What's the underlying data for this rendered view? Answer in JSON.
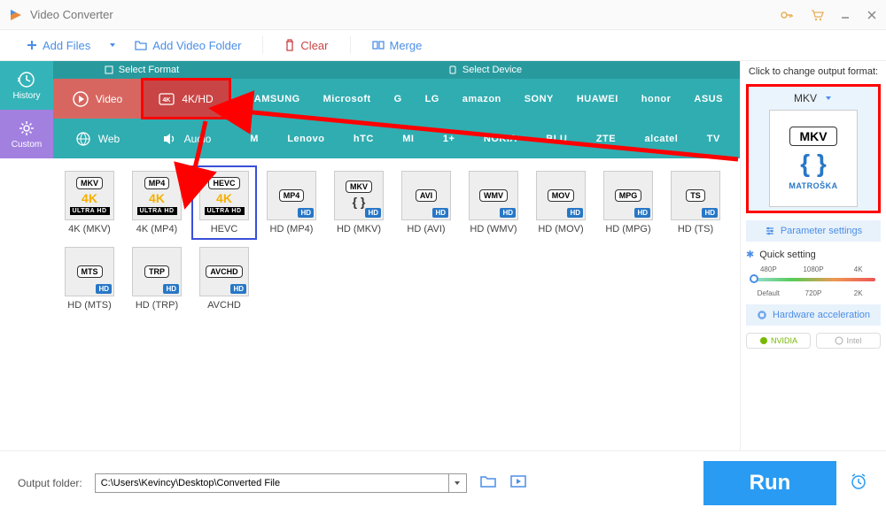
{
  "window": {
    "title": "Video Converter"
  },
  "toolbar": {
    "add_files": "Add Files",
    "add_folder": "Add Video Folder",
    "clear": "Clear",
    "merge": "Merge"
  },
  "left_tabs": {
    "history": "History",
    "custom": "Custom"
  },
  "ribbon": {
    "select_format": "Select Format",
    "select_device": "Select Device",
    "row1": {
      "video": "Video",
      "fourk": "4K/HD",
      "brands": [
        "SAMSUNG",
        "Microsoft",
        "G",
        "LG",
        "amazon",
        "SONY",
        "HUAWEI",
        "honor",
        "ASUS"
      ]
    },
    "row2": {
      "web": "Web",
      "audio": "Audio",
      "brands": [
        "M",
        "Lenovo",
        "hTC",
        "MI",
        "1+",
        "NOKIA",
        "BLU",
        "ZTE",
        "alcatel",
        "TV"
      ]
    }
  },
  "formats": [
    {
      "top": "MKV",
      "mid": "4K",
      "bot": "ULTRA HD",
      "label": "4K (MKV)",
      "midColor": "#f5b000",
      "hd": false
    },
    {
      "top": "MP4",
      "mid": "4K",
      "bot": "ULTRA HD",
      "label": "4K (MP4)",
      "midColor": "#f5b000",
      "hd": false
    },
    {
      "top": "HEVC",
      "mid": "4K",
      "bot": "ULTRA HD",
      "label": "HEVC",
      "midColor": "#f5b000",
      "selected": true,
      "hd": false
    },
    {
      "top": "MP4",
      "mid": "",
      "bot": "",
      "label": "HD (MP4)",
      "hd": true
    },
    {
      "top": "MKV",
      "mid": "{ }",
      "bot": "",
      "label": "HD (MKV)",
      "hd": true
    },
    {
      "top": "AVI",
      "mid": "",
      "bot": "",
      "label": "HD (AVI)",
      "hd": true
    },
    {
      "top": "WMV",
      "mid": "",
      "bot": "",
      "label": "HD (WMV)",
      "hd": true
    },
    {
      "top": "MOV",
      "mid": "",
      "bot": "",
      "label": "HD (MOV)",
      "hd": true
    },
    {
      "top": "MPG",
      "mid": "",
      "bot": "",
      "label": "HD (MPG)",
      "hd": true
    },
    {
      "top": "TS",
      "mid": "",
      "bot": "",
      "label": "HD (TS)",
      "hd": true
    },
    {
      "top": "MTS",
      "mid": "",
      "bot": "",
      "label": "HD (MTS)",
      "hd": true
    },
    {
      "top": "TRP",
      "mid": "",
      "bot": "",
      "label": "HD (TRP)",
      "hd": true
    },
    {
      "top": "AVCHD",
      "mid": "",
      "bot": "",
      "label": "AVCHD",
      "hd": true
    }
  ],
  "right": {
    "click_text": "Click to change output format:",
    "format_name": "MKV",
    "preview_label": "MKV",
    "preview_brand": "MATROŠKA",
    "param_settings": "Parameter settings",
    "quick_setting": "Quick setting",
    "ticks_top": [
      "480P",
      "1080P",
      "4K"
    ],
    "ticks_bot": [
      "Default",
      "720P",
      "2K"
    ],
    "hw_accel": "Hardware acceleration",
    "nvidia": "NVIDIA",
    "intel": "Intel"
  },
  "footer": {
    "label": "Output folder:",
    "path": "C:\\Users\\Kevincy\\Desktop\\Converted File",
    "run": "Run"
  }
}
